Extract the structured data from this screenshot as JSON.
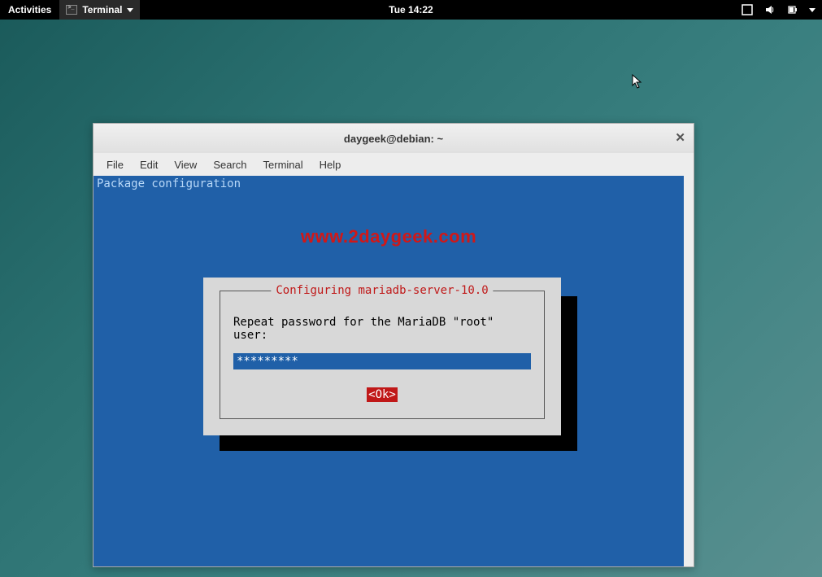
{
  "topbar": {
    "activities": "Activities",
    "app_name": "Terminal",
    "clock": "Tue 14:22"
  },
  "window": {
    "title": "daygeek@debian: ~",
    "menu": {
      "file": "File",
      "edit": "Edit",
      "view": "View",
      "search": "Search",
      "terminal": "Terminal",
      "help": "Help"
    }
  },
  "terminal": {
    "header_line": "Package configuration",
    "watermark": "www.2daygeek.com",
    "dialog": {
      "title": "Configuring mariadb-server-10.0",
      "prompt": "Repeat password for the MariaDB \"root\" user:",
      "password_value": "*********",
      "ok_label": "<Ok>"
    }
  }
}
